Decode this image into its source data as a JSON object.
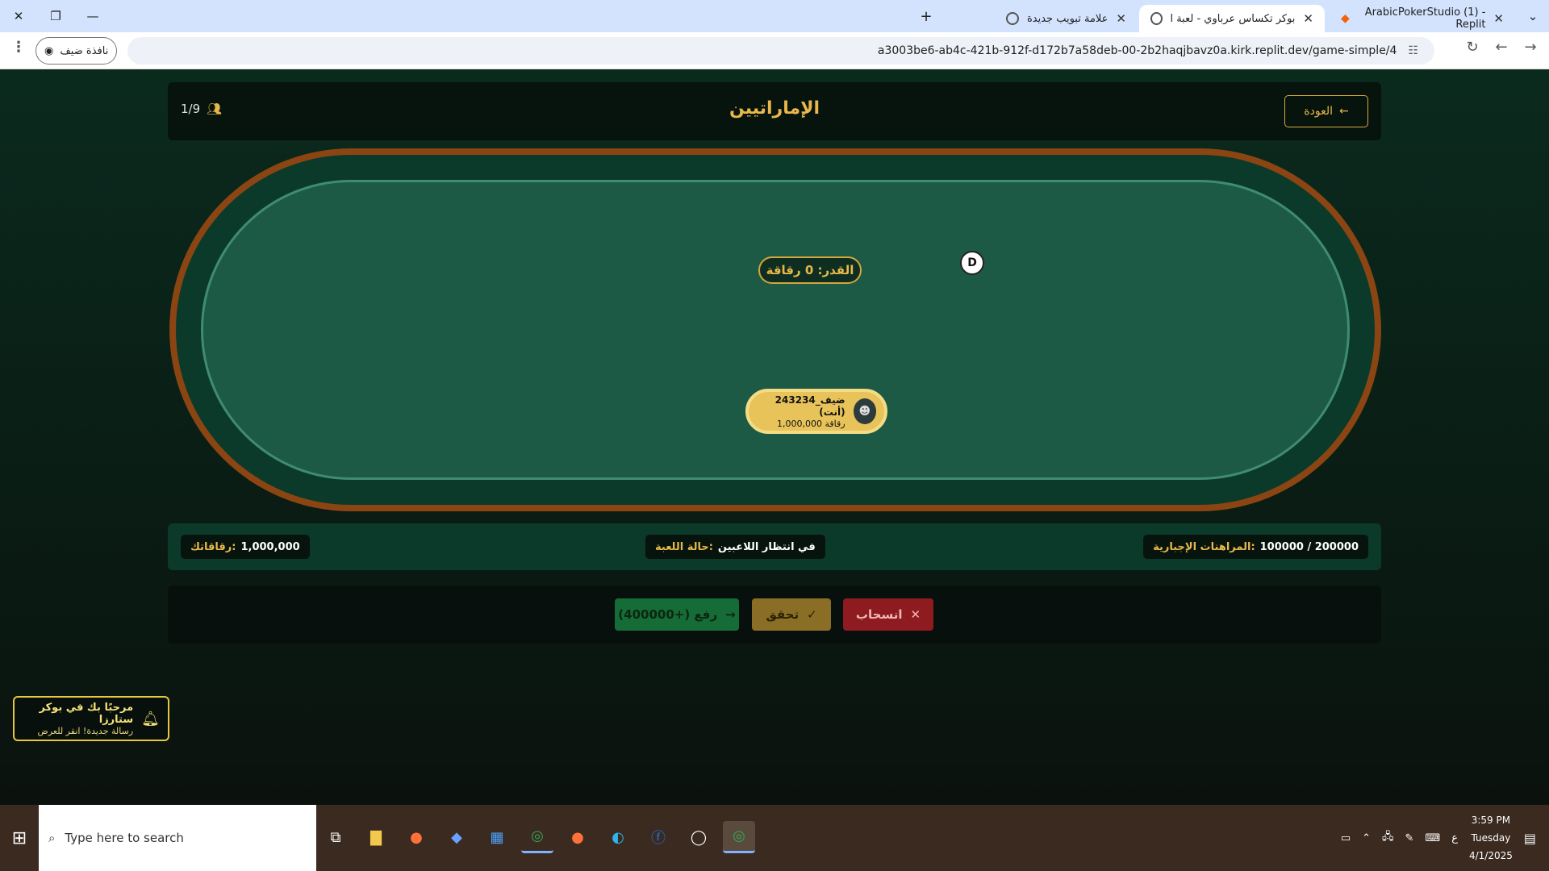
{
  "browser": {
    "tabs": [
      {
        "title": "ArabicPokerStudio (1) - Replit"
      },
      {
        "title": "بوكر تكساس عرباوي - لعبة البوكر"
      },
      {
        "title": "علامة تبويب جديدة"
      }
    ],
    "url": "a3003be6-ab4c-421b-912f-d172b7a58deb-00-2b2haqjbavz0a.kirk.replit.dev/game-simple/4",
    "guest_label": "نافذة ضيف"
  },
  "game": {
    "title": "الإماراتيين",
    "back_label": "العودة",
    "player_count": "1/9",
    "pot_label": "القدر: 0 رقاقة",
    "dealer_marker": "D",
    "player": {
      "name": "ضيف_243234 (أنت)",
      "chips": "1,000,000 رقاقة"
    },
    "info": {
      "blinds_label": "المراهنات الإجبارية:",
      "blinds_value": "100000 / 200000",
      "status_label": "حالة اللعبة:",
      "status_value": "في انتظار اللاعبين",
      "chips_label": "رقاقاتك:",
      "chips_value": "1,000,000"
    },
    "actions": {
      "fold": "انسحاب",
      "check": "تحقق",
      "raise": "رفع (+400000)"
    },
    "toast": {
      "title": "مرحبًا بك في بوكر ستارزا",
      "subtitle": "رسالة جديدة! انقر للعرض"
    }
  },
  "taskbar": {
    "search_placeholder": "Type here to search",
    "time": "3:59 PM",
    "day": "Tuesday",
    "date": "4/1/2025",
    "lang": "ع"
  },
  "colors": {
    "accent_gold": "#e8b84a",
    "felt": "#1d5a45",
    "rail": "#8b4513",
    "fold": "#8e1b1f",
    "check": "#8a6e25",
    "raise": "#166c36"
  }
}
